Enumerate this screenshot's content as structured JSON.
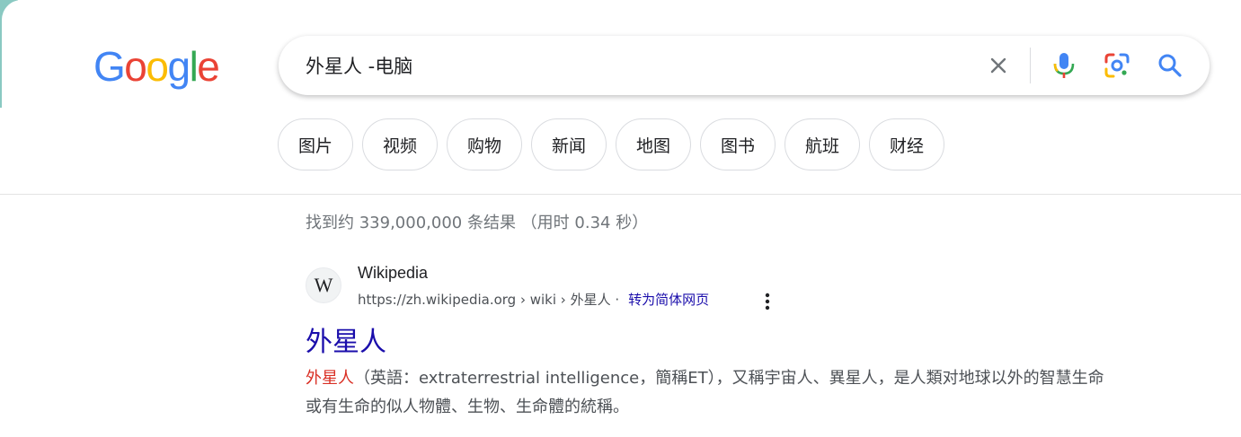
{
  "logo": {
    "letters": [
      "G",
      "o",
      "o",
      "g",
      "l",
      "e"
    ],
    "colors": [
      "#4285F4",
      "#EA4335",
      "#FBBC05",
      "#4285F4",
      "#34A853",
      "#EA4335"
    ]
  },
  "search": {
    "query": "外星人 -电脑",
    "icons": [
      "clear-icon",
      "mic-icon",
      "lens-icon",
      "search-icon"
    ]
  },
  "chips": [
    {
      "label": "图片"
    },
    {
      "label": "视频"
    },
    {
      "label": "购物"
    },
    {
      "label": "新闻"
    },
    {
      "label": "地图"
    },
    {
      "label": "图书"
    },
    {
      "label": "航班"
    },
    {
      "label": "财经"
    }
  ],
  "stats": "找到约 339,000,000 条结果 （用时 0.34 秒）",
  "result": {
    "favicon": "W",
    "site_name": "Wikipedia",
    "url": "https://zh.wikipedia.org › wiki › 外星人 ·",
    "translate": "转为简体网页",
    "title": "外星人",
    "snippet_highlight": "外星人",
    "snippet_rest": "（英語：extraterrestrial intelligence，簡稱ET），又稱宇宙人、異星人，是人類对地球以外的智慧生命或有生命的似人物體、生物、生命體的統稱。"
  },
  "colors": {
    "link": "#1a0dab",
    "highlight": "#d93025",
    "muted": "#70757a"
  }
}
